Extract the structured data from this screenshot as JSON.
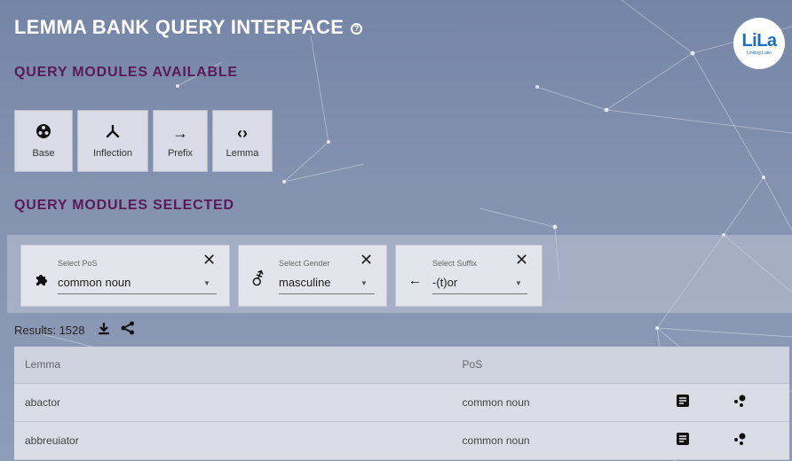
{
  "header": {
    "title": "LEMMA BANK QUERY INTERFACE",
    "help_icon": "question-circle-icon",
    "logo": {
      "main": "LiLa",
      "sub": "Linking Latin"
    }
  },
  "available": {
    "heading": "QUERY MODULES AVAILABLE",
    "modules": [
      {
        "label": "Base",
        "icon": "base-icon"
      },
      {
        "label": "Inflection",
        "icon": "inflection-icon"
      },
      {
        "label": "Prefix",
        "icon": "arrow-right-icon"
      },
      {
        "label": "Lemma",
        "icon": "code-brackets-icon"
      }
    ]
  },
  "selected": {
    "heading": "QUERY MODULES SELECTED",
    "filters": [
      {
        "caption": "Select PoS",
        "value": "common noun",
        "icon": "puzzle-icon"
      },
      {
        "caption": "Select Gender",
        "value": "masculine",
        "icon": "gender-icon"
      },
      {
        "caption": "Select Suffix",
        "value": "-(t)or",
        "icon": "arrow-left-icon"
      }
    ]
  },
  "results": {
    "label": "Results: 1528",
    "download_icon": "download-icon",
    "share_icon": "share-icon"
  },
  "table": {
    "columns": [
      "Lemma",
      "PoS"
    ],
    "rows": [
      {
        "lemma": "abactor",
        "pos": "common noun"
      },
      {
        "lemma": "abbreuiator",
        "pos": "common noun"
      }
    ]
  },
  "colors": {
    "heading": "#5a1a5a",
    "background": "#8492b0"
  }
}
